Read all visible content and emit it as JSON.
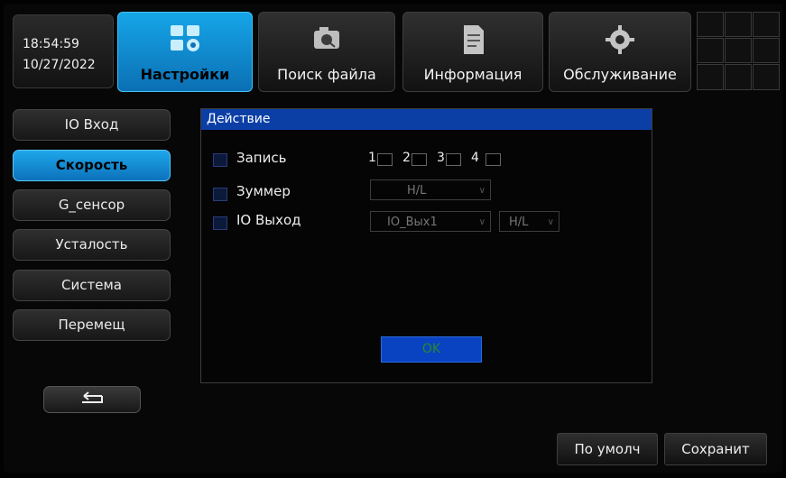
{
  "clock": {
    "time": "18:54:59",
    "date": "10/27/2022"
  },
  "tabs": [
    {
      "label": "Настройки",
      "icon": "settings-icon",
      "active": true
    },
    {
      "label": "Поиск файла",
      "icon": "camera-search-icon",
      "active": false
    },
    {
      "label": "Информация",
      "icon": "document-icon",
      "active": false
    },
    {
      "label": "Обслуживание",
      "icon": "gear-icon",
      "active": false
    }
  ],
  "sidebar": {
    "items": [
      {
        "label": "IO Вход",
        "active": false
      },
      {
        "label": "Скорость",
        "active": true
      },
      {
        "label": "G_сенсор",
        "active": false
      },
      {
        "label": "Усталость",
        "active": false
      },
      {
        "label": "Система",
        "active": false
      },
      {
        "label": "Перемещ",
        "active": false
      }
    ],
    "back_icon": "return-arrow-icon"
  },
  "panel": {
    "title": "Действие",
    "record_label": "Запись",
    "channels": [
      "1",
      "2",
      "3",
      "4"
    ],
    "buzzer_label": "Зуммер",
    "buzzer_value": "H/L",
    "io_out_label": "IO Выход",
    "io_out_value": "IO_Вых1",
    "io_level_value": "H/L",
    "ok_label": "OK"
  },
  "footer": {
    "default_label": "По умолч",
    "save_label": "Сохранит"
  },
  "colors": {
    "accent": "#0c72bb",
    "title_bar": "#0b3fa6",
    "ok_button": "#0a43c2"
  }
}
